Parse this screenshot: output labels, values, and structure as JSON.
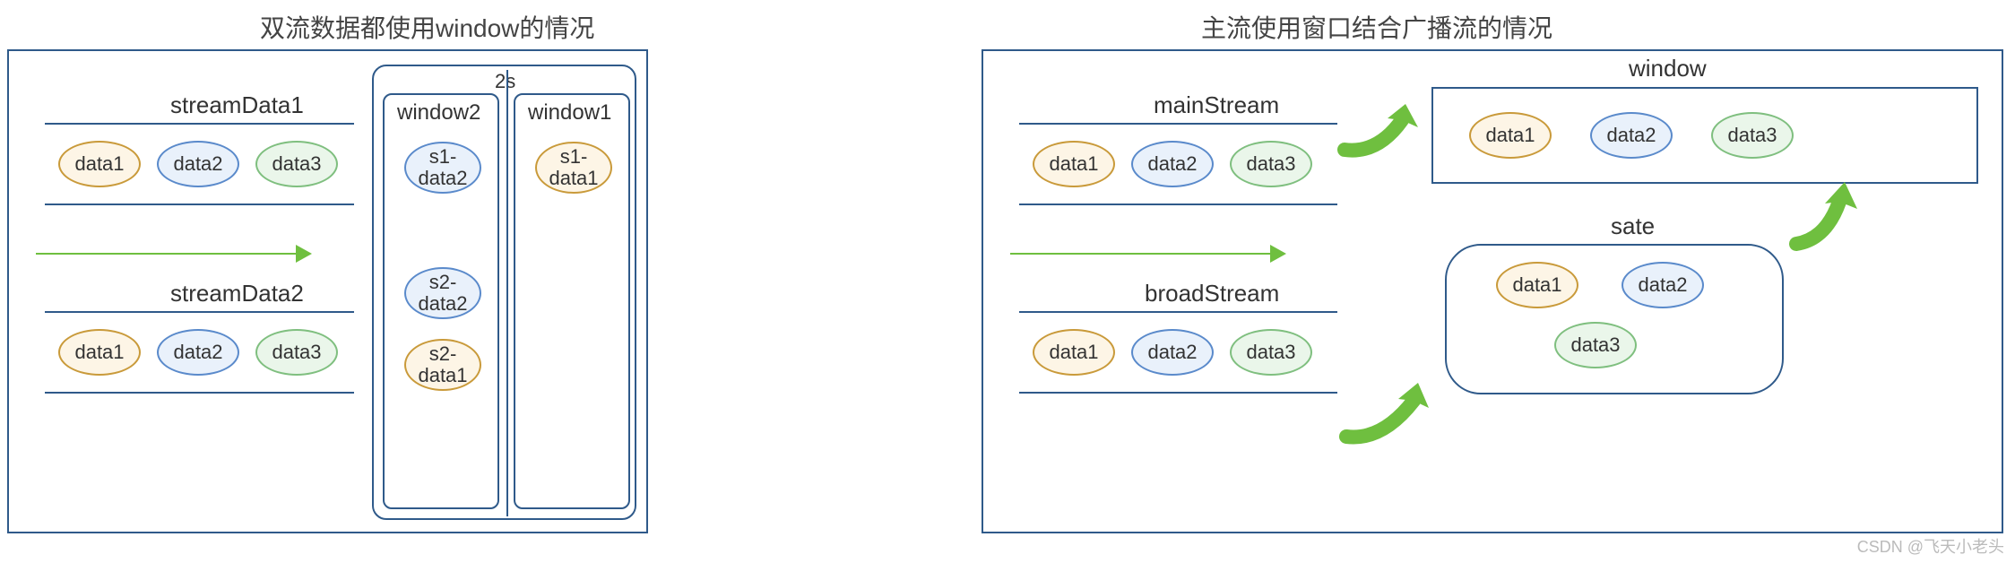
{
  "left": {
    "title": "双流数据都使用window的情况",
    "stream1": {
      "label": "streamData1",
      "items": [
        {
          "text": "data1",
          "color": "orange"
        },
        {
          "text": "data2",
          "color": "blue"
        },
        {
          "text": "data3",
          "color": "green"
        }
      ]
    },
    "stream2": {
      "label": "streamData2",
      "items": [
        {
          "text": "data1",
          "color": "orange"
        },
        {
          "text": "data2",
          "color": "blue"
        },
        {
          "text": "data3",
          "color": "green"
        }
      ]
    },
    "windows": {
      "tick_label": "2s",
      "window2": {
        "label": "window2",
        "items": [
          {
            "text": "s1-data2",
            "color": "blue"
          },
          {
            "text": "s2-data2",
            "color": "blue"
          },
          {
            "text": "s2-data1",
            "color": "orange"
          }
        ]
      },
      "window1": {
        "label": "window1",
        "items": [
          {
            "text": "s1-data1",
            "color": "orange"
          }
        ]
      }
    }
  },
  "right": {
    "title": "主流使用窗口结合广播流的情况",
    "main_stream": {
      "label": "mainStream",
      "items": [
        {
          "text": "data1",
          "color": "orange"
        },
        {
          "text": "data2",
          "color": "blue"
        },
        {
          "text": "data3",
          "color": "green"
        }
      ]
    },
    "broad_stream": {
      "label": "broadStream",
      "items": [
        {
          "text": "data1",
          "color": "orange"
        },
        {
          "text": "data2",
          "color": "blue"
        },
        {
          "text": "data3",
          "color": "green"
        }
      ]
    },
    "window": {
      "label": "window",
      "items": [
        {
          "text": "data1",
          "color": "orange"
        },
        {
          "text": "data2",
          "color": "blue"
        },
        {
          "text": "data3",
          "color": "green"
        }
      ]
    },
    "state": {
      "label": "sate",
      "items": [
        {
          "text": "data1",
          "color": "orange"
        },
        {
          "text": "data2",
          "color": "blue"
        },
        {
          "text": "data3",
          "color": "green"
        }
      ]
    }
  },
  "watermark": "CSDN @飞天小老头"
}
